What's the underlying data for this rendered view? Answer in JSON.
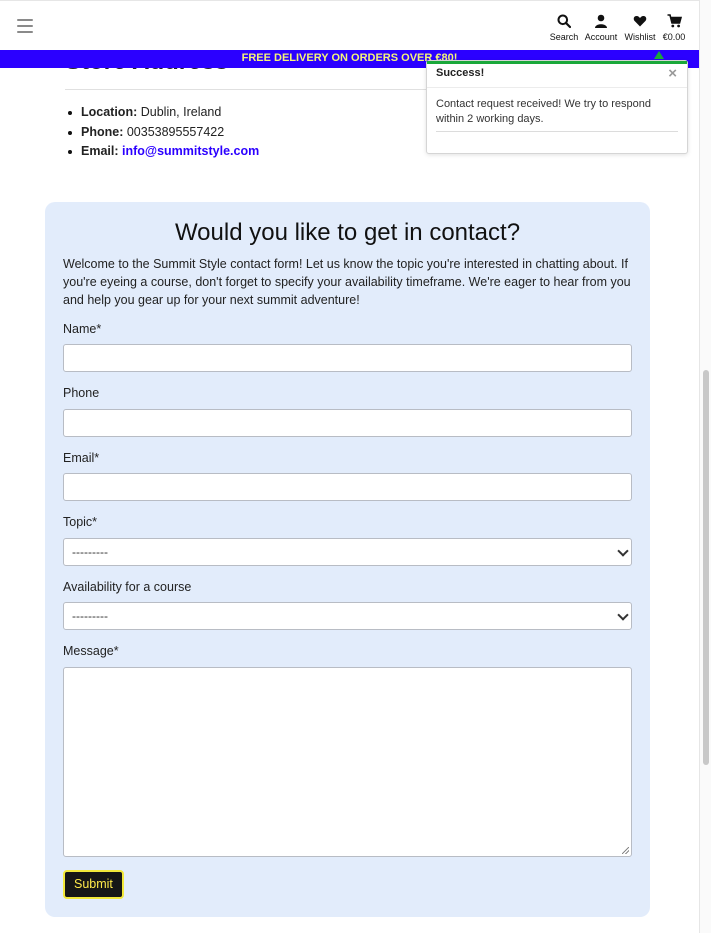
{
  "header": {
    "nav": [
      {
        "label": "Search",
        "icon": "search-icon"
      },
      {
        "label": "Account",
        "icon": "user-icon"
      },
      {
        "label": "Wishlist",
        "icon": "heart-icon"
      },
      {
        "label": "€0.00",
        "icon": "cart-icon"
      }
    ]
  },
  "banner": {
    "text": "FREE DELIVERY ON ORDERS OVER €80!"
  },
  "store": {
    "heading": "Store Address",
    "items": [
      {
        "label": "Location:",
        "value": "Dublin, Ireland"
      },
      {
        "label": "Phone:",
        "value": "00353895557422"
      },
      {
        "label": "Email:",
        "value": "info@summitstyle.com"
      }
    ]
  },
  "toast": {
    "title": "Success!",
    "close": "×",
    "message": "Contact request received! We try to respond within 2 working days."
  },
  "contact": {
    "title": "Would you like to get in contact?",
    "intro": "Welcome to the Summit Style contact form! Let us know the topic you're interested in chatting about. If you're eyeing a course, don't forget to specify your availability timeframe. We're eager to hear from you and help you gear up for your next summit adventure!",
    "fields": {
      "name": {
        "label": "Name*",
        "value": ""
      },
      "phone": {
        "label": "Phone",
        "value": ""
      },
      "email": {
        "label": "Email*",
        "value": ""
      },
      "topic": {
        "label": "Topic*",
        "selected": "---------"
      },
      "availability": {
        "label": "Availability for a course",
        "selected": "---------"
      },
      "message": {
        "label": "Message*",
        "value": ""
      }
    },
    "submit": "Submit"
  },
  "colors": {
    "brand_blue": "#2b00ff",
    "banner_text": "#f4f47a",
    "card_bg": "#e2ecfb",
    "success_green": "#1aa83a",
    "submit_bg": "#161616",
    "submit_text": "#ffe94a"
  }
}
